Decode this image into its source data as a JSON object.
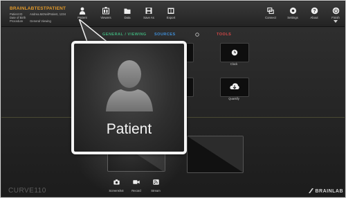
{
  "patient": {
    "name": "BRAINLABTESTPATIENT",
    "rows": [
      {
        "key": "Patient ID",
        "value": "Andrea.McNeilPatient, 1234"
      },
      {
        "key": "Date of Birth",
        "value": ""
      },
      {
        "key": "Procedure",
        "value": "General Viewing"
      }
    ]
  },
  "toolbar_left": [
    {
      "id": "patient",
      "label": "Patient",
      "icon": "person-icon"
    },
    {
      "id": "viewers",
      "label": "Viewers",
      "icon": "viewers-icon"
    },
    {
      "id": "data",
      "label": "Data",
      "icon": "folder-icon"
    },
    {
      "id": "save",
      "label": "Save As",
      "icon": "save-icon"
    },
    {
      "id": "export",
      "label": "Export",
      "icon": "export-icon"
    }
  ],
  "toolbar_right": [
    {
      "id": "connect",
      "label": "Connect",
      "icon": "connect-icon"
    },
    {
      "id": "settings",
      "label": "Settings",
      "icon": "gear-icon"
    },
    {
      "id": "about",
      "label": "About",
      "icon": "help-icon"
    },
    {
      "id": "finish",
      "label": "Finish",
      "icon": "power-icon"
    }
  ],
  "sections": {
    "general": "GENERAL / VIEWING",
    "sources": "SOURCES",
    "tools": "TOOLS"
  },
  "apps": {
    "clock": "Clock",
    "quantify": "Quantify"
  },
  "bottom_actions": [
    {
      "id": "screenshot",
      "label": "Screenshot",
      "icon": "camera-icon"
    },
    {
      "id": "record",
      "label": "Record",
      "icon": "video-icon"
    },
    {
      "id": "stream",
      "label": "Stream",
      "icon": "stream-icon"
    }
  ],
  "footer": {
    "product": "CURVE110",
    "brand": "BRAINLAB"
  },
  "callout": {
    "label": "Patient",
    "icon": "person-icon"
  },
  "colors": {
    "patient_name": "#e39a2a",
    "general_section": "#3fae7a",
    "sources_section": "#3f8fd8",
    "tools_section": "#d84848"
  }
}
